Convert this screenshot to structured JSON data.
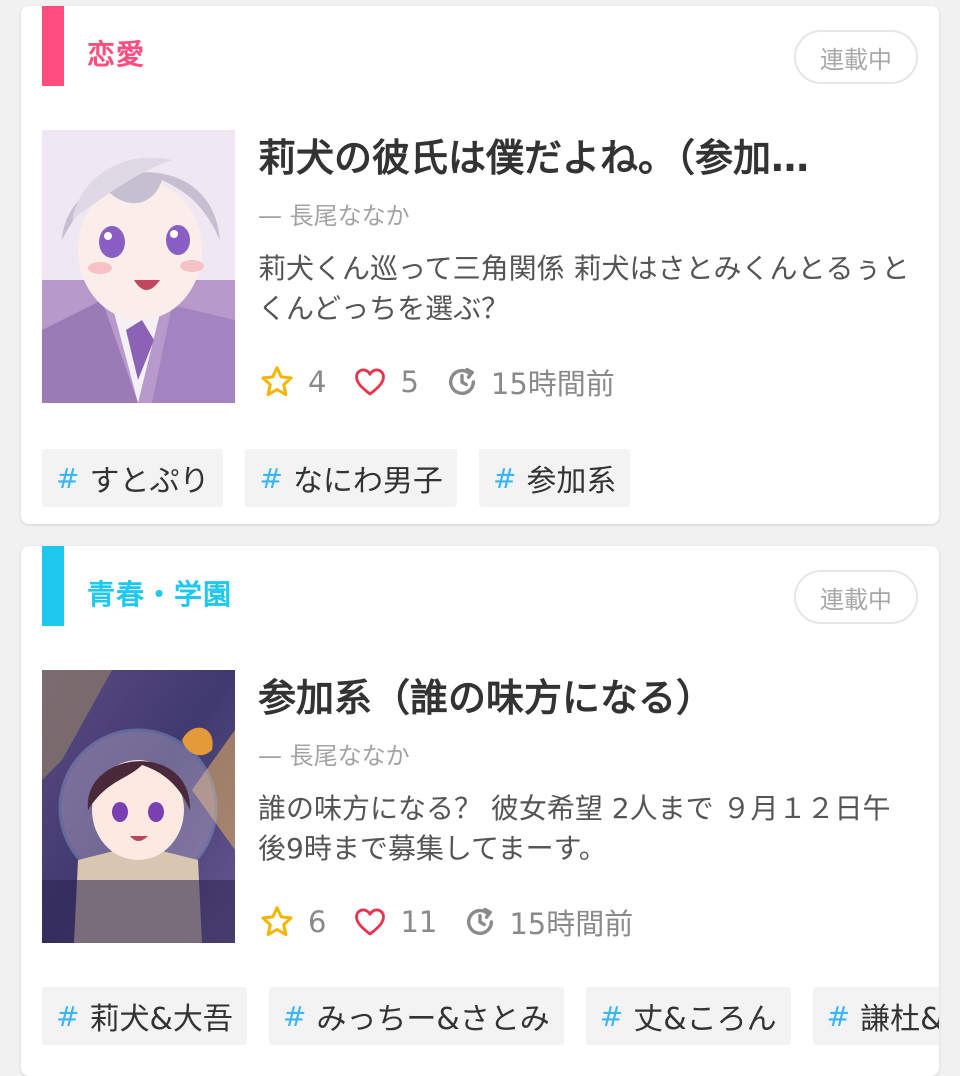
{
  "colors": {
    "romance_accent": "#ff4d7f",
    "school_accent": "#1ec8ee",
    "hash": "#3cb6f0",
    "star": "#f5b400",
    "heart": "#e8344e"
  },
  "stories": [
    {
      "genre": "恋愛",
      "status": "連載中",
      "title": "莉犬の彼氏は僕だよね。（参加…",
      "author": "— 長尾ななか",
      "description": "莉犬くん巡って三角関係 莉犬はさとみくんとるぅとくんどっちを選ぶ？",
      "stars": "4",
      "likes": "5",
      "updated": "15時間前",
      "tags": [
        "すとぷり",
        "なにわ男子",
        "参加系"
      ],
      "icons": {
        "star": "star-icon",
        "heart": "heart-icon",
        "update": "refresh-clock-icon"
      }
    },
    {
      "genre": "青春・学園",
      "status": "連載中",
      "title": "参加系（誰の味方になる）",
      "author": "— 長尾ななか",
      "description": "誰の味方になる？ 彼女希望 2人まで ９月１２日午後9時まで募集してまーす。",
      "stars": "6",
      "likes": "11",
      "updated": "15時間前",
      "tags": [
        "莉犬&大吾",
        "みっちー&さとみ",
        "丈&ころん",
        "謙杜&る"
      ],
      "icons": {
        "star": "star-icon",
        "heart": "heart-icon",
        "update": "refresh-clock-icon"
      }
    }
  ]
}
